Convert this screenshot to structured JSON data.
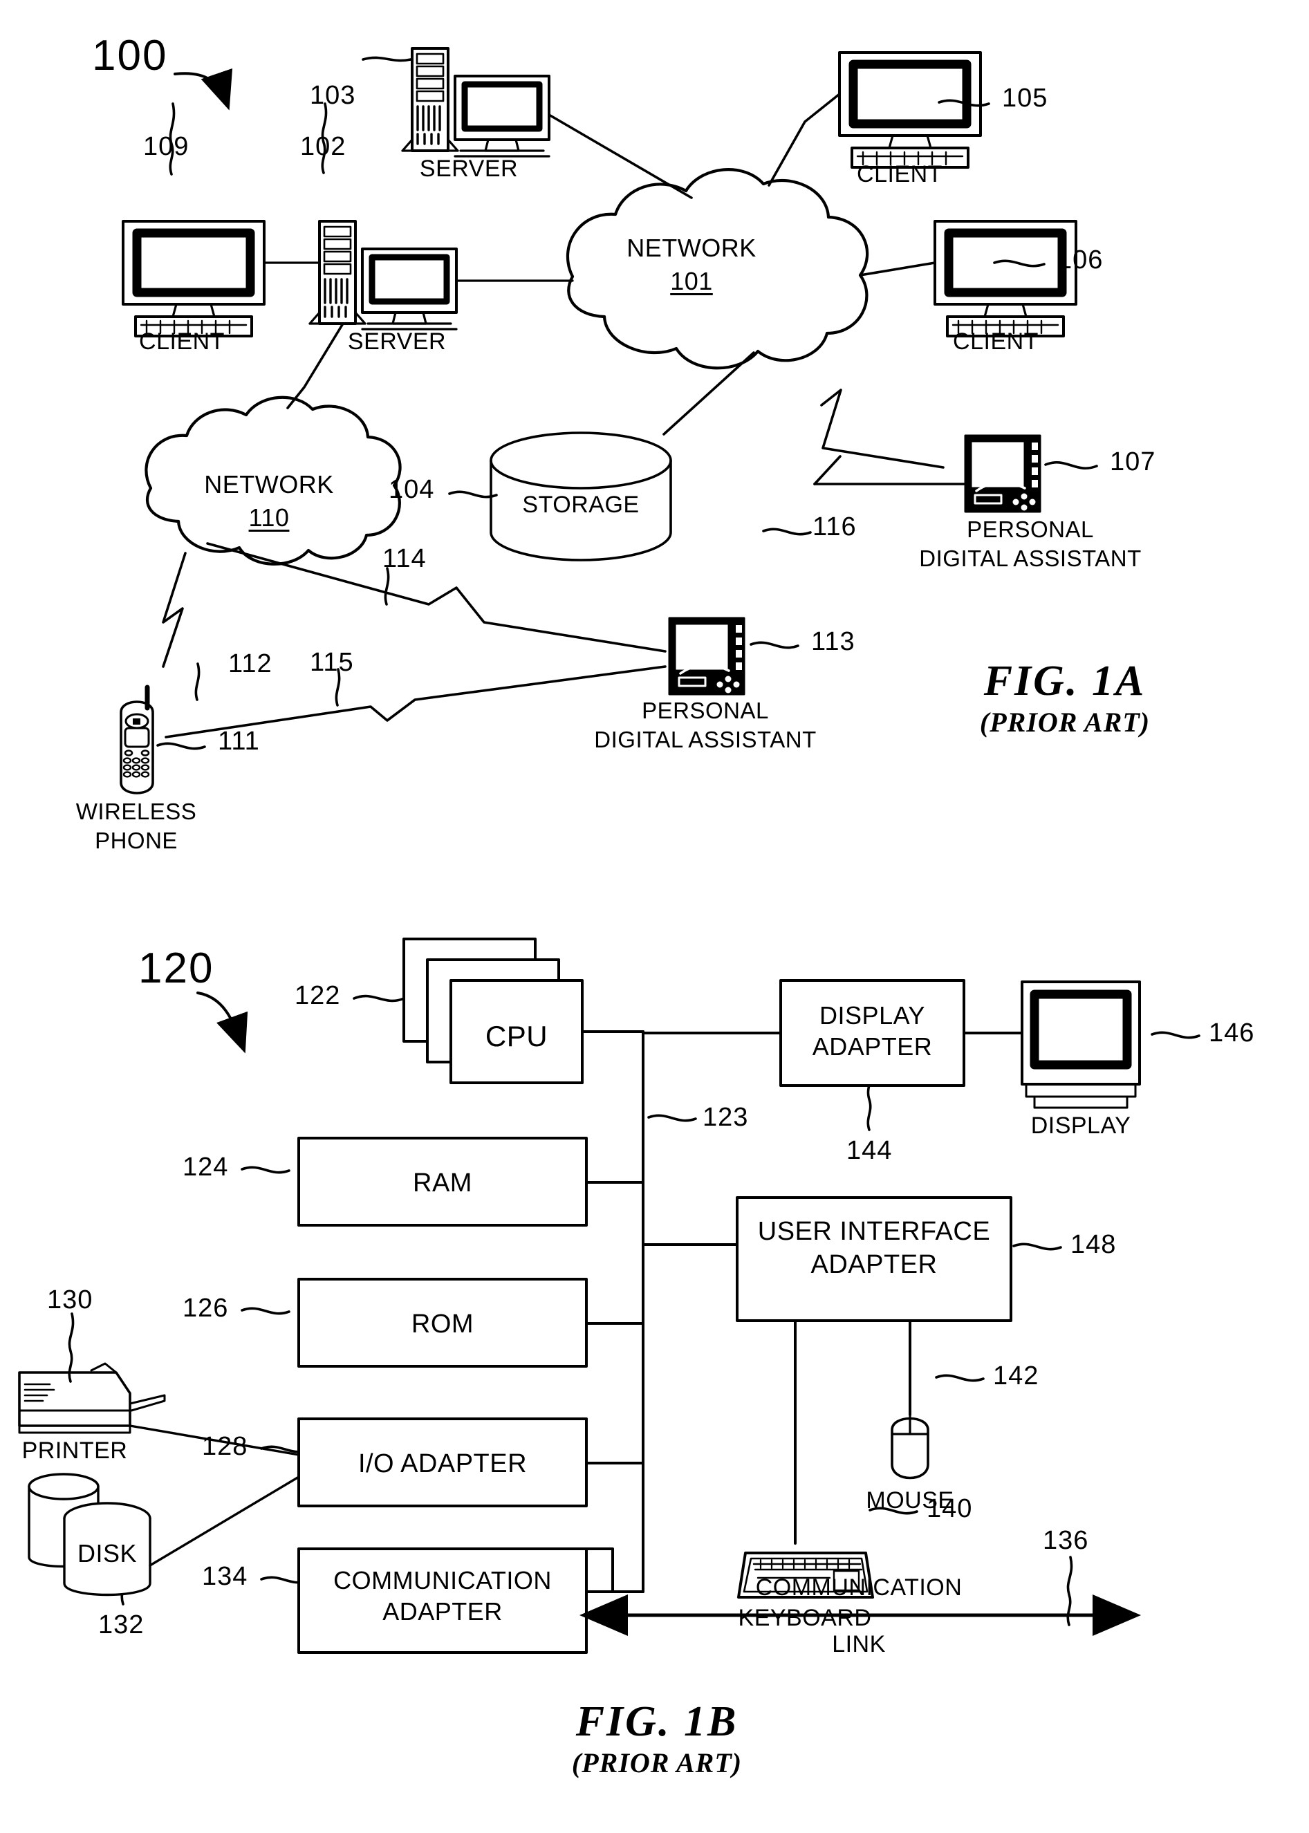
{
  "figures": [
    {
      "id": "fig-1a",
      "title": "FIG. 1A",
      "subtitle": "(PRIOR ART)",
      "system_number": "100",
      "nodes": [
        {
          "ref": "109",
          "label": "CLIENT",
          "type": "desktop-computer"
        },
        {
          "ref": "102",
          "label": "SERVER",
          "type": "server-tower"
        },
        {
          "ref": "103",
          "label": "SERVER",
          "type": "server-tower"
        },
        {
          "ref": "105",
          "label": "CLIENT",
          "type": "desktop-computer"
        },
        {
          "ref": "106",
          "label": "CLIENT",
          "type": "desktop-computer"
        },
        {
          "ref": "101",
          "label": "NETWORK",
          "type": "cloud"
        },
        {
          "ref": "110",
          "label": "NETWORK",
          "type": "cloud"
        },
        {
          "ref": "104",
          "label": "STORAGE",
          "type": "cylinder"
        },
        {
          "ref": "107",
          "label": "PERSONAL DIGITAL ASSISTANT",
          "type": "pda"
        },
        {
          "ref": "113",
          "label": "PERSONAL DIGITAL ASSISTANT",
          "type": "pda"
        },
        {
          "ref": "111",
          "label": "WIRELESS PHONE",
          "type": "mobile-phone"
        },
        {
          "ref": "112",
          "label": "",
          "type": "wireless-link"
        },
        {
          "ref": "114",
          "label": "",
          "type": "wireless-link"
        },
        {
          "ref": "115",
          "label": "",
          "type": "wireless-link"
        },
        {
          "ref": "116",
          "label": "",
          "type": "wireless-link"
        }
      ]
    },
    {
      "id": "fig-1b",
      "title": "FIG. 1B",
      "subtitle": "(PRIOR ART)",
      "system_number": "120",
      "blocks": [
        {
          "ref": "122",
          "label": "CPU"
        },
        {
          "ref": "123",
          "label": "bus"
        },
        {
          "ref": "124",
          "label": "RAM"
        },
        {
          "ref": "126",
          "label": "ROM"
        },
        {
          "ref": "128",
          "label": "I/O ADAPTER"
        },
        {
          "ref": "134",
          "label": "COMMUNICATION ADAPTER"
        },
        {
          "ref": "144",
          "label": "DISPLAY ADAPTER"
        },
        {
          "ref": "148",
          "label": "USER INTERFACE ADAPTER"
        }
      ],
      "peripherals": [
        {
          "ref": "130",
          "label": "PRINTER"
        },
        {
          "ref": "132",
          "label": "DISK"
        },
        {
          "ref": "136",
          "label": "COMMUNICATION LINK",
          "line1": "COMMUNICATION",
          "line2": "LINK"
        },
        {
          "ref": "140",
          "label": "KEYBOARD"
        },
        {
          "ref": "142",
          "label": "MOUSE"
        },
        {
          "ref": "146",
          "label": "DISPLAY"
        }
      ]
    }
  ],
  "labels": {
    "client": "CLIENT",
    "server": "SERVER",
    "network": "NETWORK",
    "storage": "STORAGE",
    "pda_line1": "PERSONAL",
    "pda_line2": "DIGITAL ASSISTANT",
    "phone_line1": "WIRELESS",
    "phone_line2": "PHONE",
    "cpu": "CPU",
    "ram": "RAM",
    "rom": "ROM",
    "io_adapter": "I/O ADAPTER",
    "comm_adapter_l1": "COMMUNICATION",
    "comm_adapter_l2": "ADAPTER",
    "display_adapter_l1": "DISPLAY",
    "display_adapter_l2": "ADAPTER",
    "ui_adapter_l1": "USER INTERFACE",
    "ui_adapter_l2": "ADAPTER",
    "display": "DISPLAY",
    "mouse": "MOUSE",
    "keyboard": "KEYBOARD",
    "printer": "PRINTER",
    "disk": "DISK",
    "comm_link_l1": "COMMUNICATION",
    "comm_link_l2": "LINK",
    "n100": "100",
    "n101": "101",
    "n102": "102",
    "n103": "103",
    "n104": "104",
    "n105": "105",
    "n106": "106",
    "n107": "107",
    "n109": "109",
    "n110": "110",
    "n111": "111",
    "n112": "112",
    "n113": "113",
    "n114": "114",
    "n115": "115",
    "n116": "116",
    "n120": "120",
    "n122": "122",
    "n123": "123",
    "n124": "124",
    "n126": "126",
    "n128": "128",
    "n130": "130",
    "n132": "132",
    "n134": "134",
    "n136": "136",
    "n140": "140",
    "n142": "142",
    "n144": "144",
    "n146": "146",
    "n148": "148",
    "fig1a": "FIG. 1A",
    "fig1b": "FIG. 1B",
    "prior_art": "(PRIOR ART)"
  },
  "colors": {
    "ink": "#000000",
    "paper": "#ffffff"
  }
}
